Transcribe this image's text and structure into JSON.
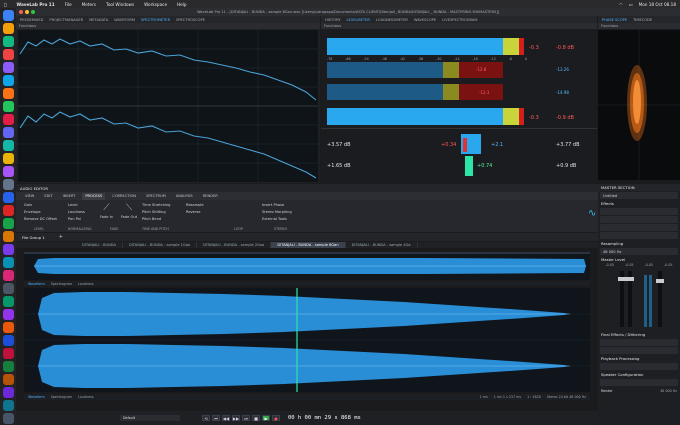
{
  "menubar": {
    "app": "WaveLab Pro 11",
    "items": [
      "File",
      "Meters",
      "Tool Windows",
      "Workspace",
      "Help"
    ],
    "datetime": "Mon 18 Oct 08.18"
  },
  "window": {
    "title": "WaveLab Pro 11 - [DITANJALI - BUNDA - sample 8Gan.wav [Users/putrapopo/Documents/ASTA CLIENT/Ditanjali_ BUNDA/DITANJALI _ BUNDA - MASTERING MIXMASTERS]]"
  },
  "meter_tabs": [
    "PEEDEMIXED",
    "PROJECTMANAGER",
    "METADATA",
    "WAVEFORM",
    "SPECTROMETER",
    "SPECTROSCOPE"
  ],
  "meter_tabs_right": [
    "HISTORY",
    "LEVELMETER",
    "LOUDNESSMETER",
    "WAVESCOPE",
    "LIVESPECTROGRAM"
  ],
  "phase_tabs": [
    "PHASE SCOPE",
    "TIMECODE"
  ],
  "panel_labels": {
    "functions": "Functions",
    "functions2": "Functions",
    "functions3": "Functions"
  },
  "levels": {
    "left_peak": "+3.57 dB",
    "left_rms": "+1.65 dB",
    "mid1": "+0.34",
    "mid2": "+2.1",
    "mid3": "+0.74",
    "right_peak": "+3.77 dB",
    "right_rms": "+0.9 dB",
    "top_red1": "-0.3",
    "top_red2": "-0.8 dB",
    "row2_a": "-12.8",
    "row2_b": "-13.26",
    "row3_a": "-12.3",
    "row3_b": "-14.98",
    "row4_red1": "-0.3",
    "row4_red2": "-0.9 dB"
  },
  "meter_scale": [
    "-78",
    "-66",
    "-54",
    "-48",
    "-42",
    "-36",
    "-30",
    "-24",
    "-18",
    "-12",
    "-6",
    "0"
  ],
  "audio_editor": {
    "label": "AUDIO EDITOR",
    "tabs": [
      "VIEW",
      "EDIT",
      "INSERT",
      "PROCESS",
      "CORRECTION",
      "SPECTRUM",
      "ANALYSIS",
      "RENDER"
    ],
    "active_tab": "PROCESS",
    "groups": {
      "level": [
        "Gain",
        "Envelope",
        "Remove DC Offset"
      ],
      "level_title": "LEVEL",
      "norm": [
        "Level",
        "Loudness",
        "Pan Pal"
      ],
      "norm_title": "NORMALIZING",
      "fade": [
        "Fade In",
        "Fade Out"
      ],
      "fade_title": "FADE",
      "time": [
        "Time Stretching",
        "Pitch Shifting",
        "Pitch Bend"
      ],
      "time_title": "TIME AND PITCH",
      "resample": [
        "Resample",
        "Reverse"
      ],
      "resample_title": "LOOP",
      "stereo": [
        "Insert Phase",
        "Stereo Morphing",
        "External Tools"
      ],
      "stereo_title": "STEREO"
    }
  },
  "file_group": "File Group 1",
  "file_tabs": [
    "DITANJALI - BUNDA",
    "DITANJALI - BUNDA - sample 1Gaa",
    "DITANJALI - BUNDA - sample 2Gaa",
    "DITANJALI - BUNDA - sample 8Gan",
    "DITANJALI - BUNDA - sample 4Ga"
  ],
  "active_file": "DITANJALI - BUNDA - sample 8Gan",
  "lane_tabs": [
    "Waveform",
    "Spectrogram",
    "Loudness"
  ],
  "status": {
    "time": "1 ms",
    "range": "1 ms 1 s 237 ms",
    "pos": "1 : 1620",
    "format": "Stereo 24 bit 48 000 Hz",
    "counter": "00 h 00 mn 29 s 868 ms"
  },
  "master_section": {
    "title": "MASTER SECTION",
    "preset": "Untitled",
    "effects": "Effects",
    "resampling": "Resampling",
    "sample_rate": "48 000 Hz",
    "master_level": "Master Level",
    "level_vals": [
      "-0.05",
      "-0.05",
      "-0.05",
      "-0.05"
    ],
    "final_effects": "Final Effects / Dithering",
    "playback": "Playback Processing",
    "speaker": "Speaker Configuration",
    "render": "Render",
    "bottom_rate": "48 000 Hz"
  },
  "bottom_left": "Default",
  "colors": {
    "accent": "#4fb3ff",
    "meter_blue": "#29a8f0",
    "meter_yellow": "#c9d33a",
    "meter_red": "#d41f1f",
    "wave_blue": "#2a8ed6",
    "playhead": "#2be6a6",
    "phase_orange": "#ff7a1a"
  }
}
